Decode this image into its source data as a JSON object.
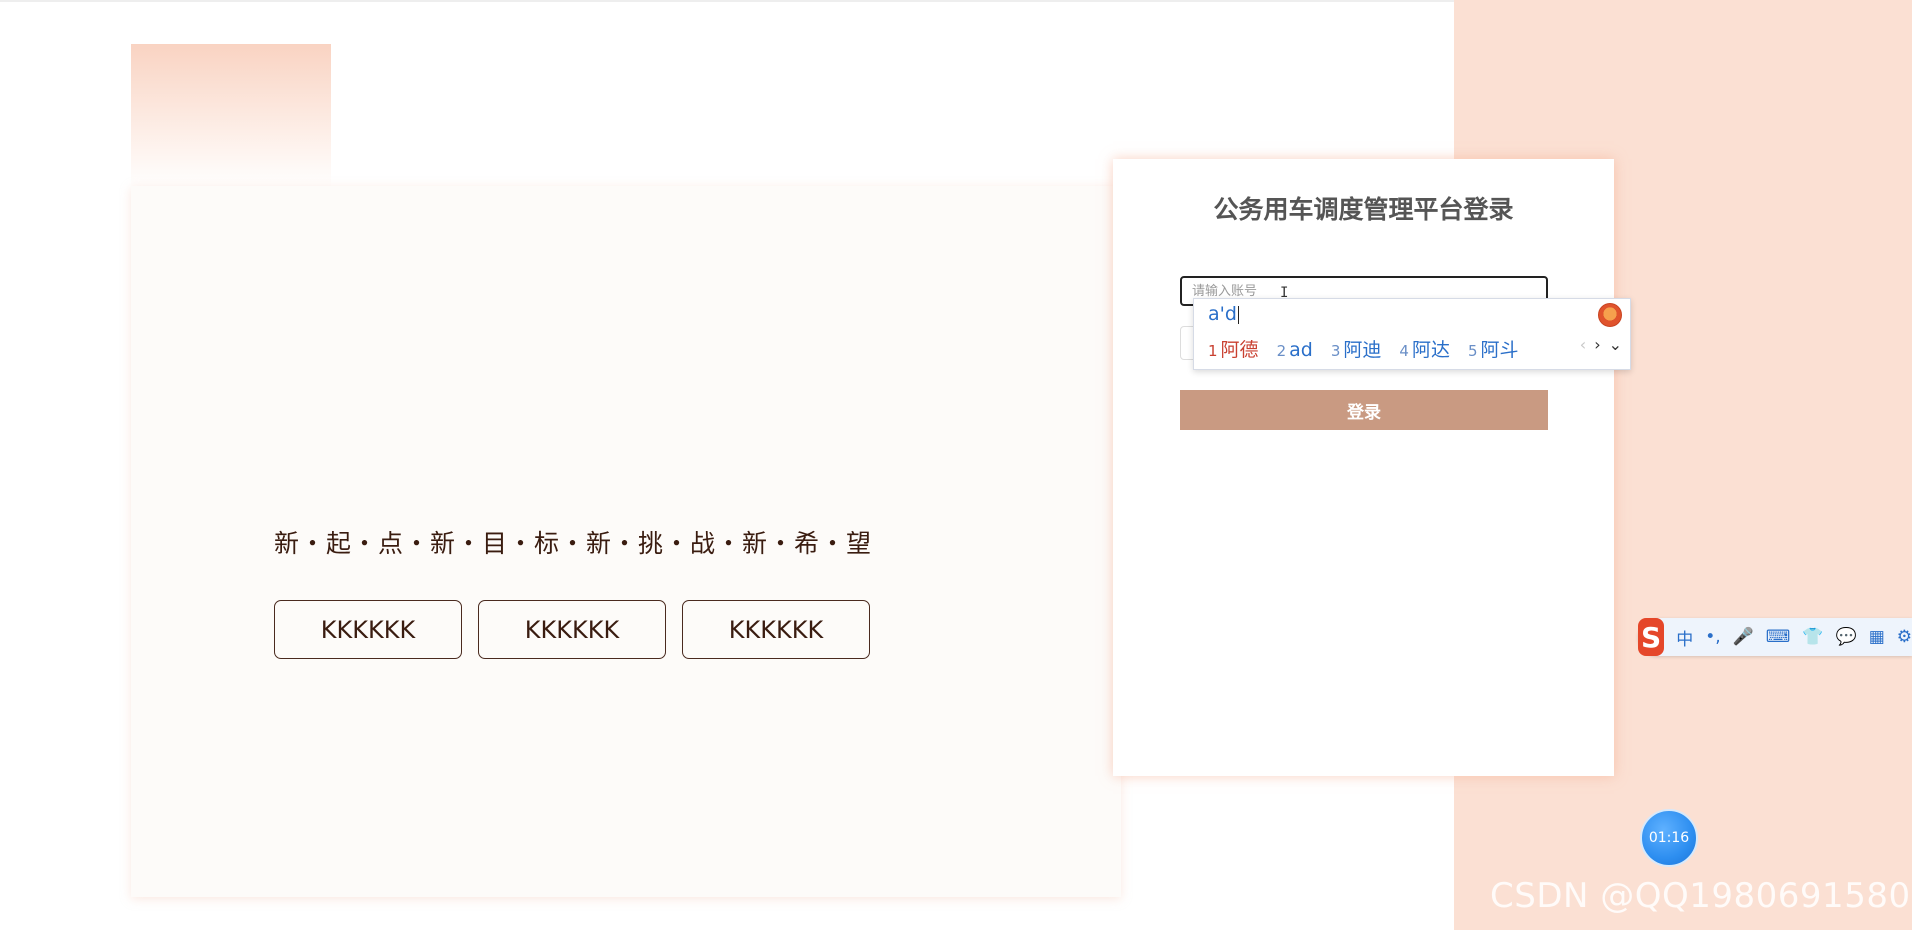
{
  "hero": {
    "slogan": "新・起・点・新・目・标・新・挑・战・新・希・望",
    "buttons": [
      "KKKKKK",
      "KKKKKK",
      "KKKKKK"
    ]
  },
  "login": {
    "title": "公务用车调度管理平台登录",
    "account_placeholder": "请输入账号",
    "login_label": "登录"
  },
  "ime": {
    "composition": "a'd",
    "candidates": [
      {
        "num": "1",
        "text": "阿德"
      },
      {
        "num": "2",
        "text": "ad"
      },
      {
        "num": "3",
        "text": "阿迪"
      },
      {
        "num": "4",
        "text": "阿达"
      },
      {
        "num": "5",
        "text": "阿斗"
      }
    ],
    "nav_prev": "‹",
    "nav_next": "›",
    "nav_expand": "⌄",
    "toolbar": {
      "logo": "S",
      "lang": "中",
      "punct": "•,",
      "mic": "🎤",
      "keyboard": "⌨",
      "skin": "👕",
      "chat": "💬",
      "apps": "▦",
      "settings": "⚙"
    }
  },
  "timer": "01:16",
  "watermark": "CSDN @QQ1980691580"
}
